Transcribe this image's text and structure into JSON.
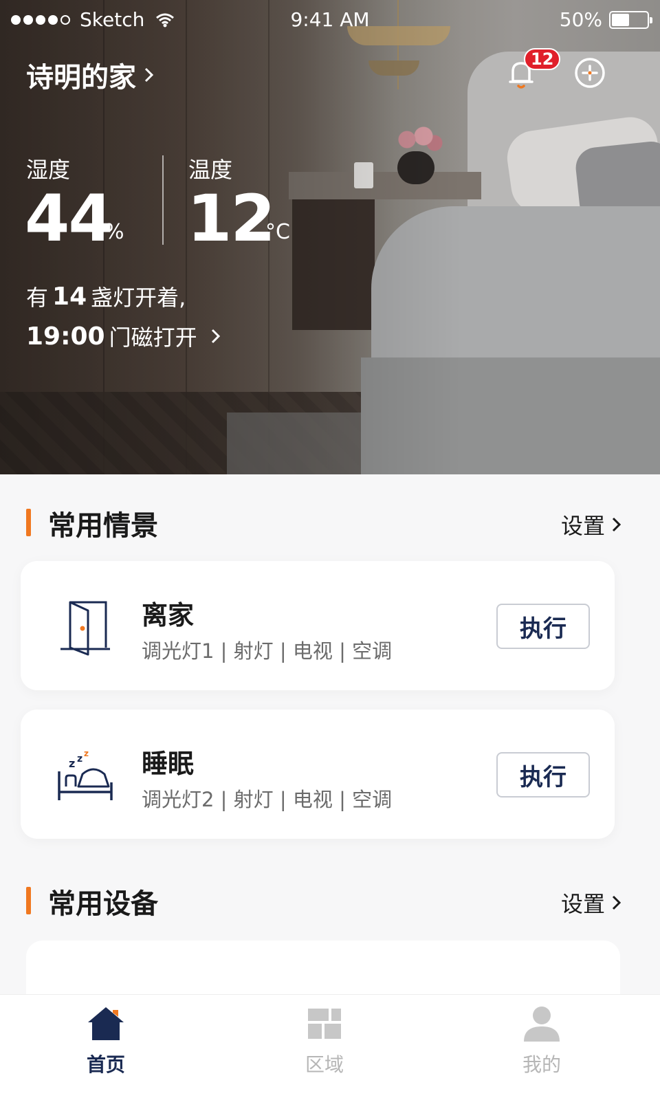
{
  "status_bar": {
    "carrier": "Sketch",
    "time": "9:41 AM",
    "battery_text": "50%",
    "battery_level": 0.5
  },
  "header": {
    "home_name": "诗明的家",
    "notification_count": "12"
  },
  "environment": {
    "humidity_label": "湿度",
    "humidity_value": "44",
    "humidity_unit": "%",
    "temperature_label": "温度",
    "temperature_value": "12",
    "temperature_unit": "°C"
  },
  "summary": {
    "line1_prefix": "有",
    "line1_count": "14",
    "line1_suffix": "盏灯开着,",
    "line2_time": "19:00",
    "line2_text": "门磁打开"
  },
  "scenes_section": {
    "title": "常用情景",
    "link": "设置",
    "items": [
      {
        "name": "离家",
        "devices": "调光灯1 | 射灯 | 电视 | 空调",
        "action": "执行",
        "icon": "door-open-icon"
      },
      {
        "name": "睡眠",
        "devices": "调光灯2 | 射灯 | 电视 | 空调",
        "action": "执行",
        "icon": "bed-sleep-icon"
      }
    ]
  },
  "devices_section": {
    "title": "常用设备",
    "link": "设置"
  },
  "tabbar": {
    "tabs": [
      {
        "label": "首页",
        "icon": "home-icon",
        "active": true
      },
      {
        "label": "区域",
        "icon": "grid-icon",
        "active": false
      },
      {
        "label": "我的",
        "icon": "user-icon",
        "active": false
      }
    ]
  },
  "colors": {
    "accent": "#f07820",
    "primary_dark": "#1a2a52",
    "badge": "#e01f2a"
  }
}
